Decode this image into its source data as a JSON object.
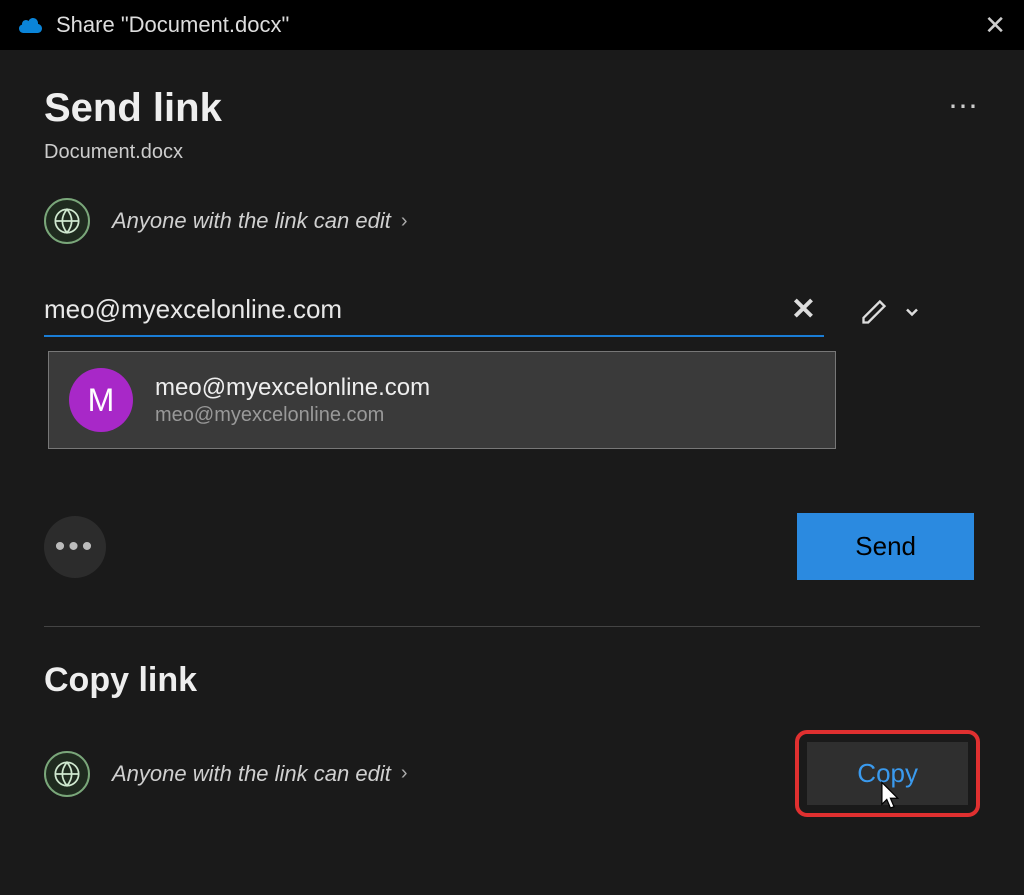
{
  "titlebar": {
    "title": "Share \"Document.docx\""
  },
  "header": {
    "title": "Send link",
    "document": "Document.docx"
  },
  "permission": {
    "text": "Anyone with the link can edit"
  },
  "input": {
    "value": "meo@myexcelonline.com"
  },
  "suggestion": {
    "avatar_initial": "M",
    "name": "meo@myexcelonline.com",
    "email": "meo@myexcelonline.com"
  },
  "actions": {
    "send": "Send"
  },
  "copy_section": {
    "title": "Copy link",
    "permission_text": "Anyone with the link can edit",
    "copy_button": "Copy"
  }
}
